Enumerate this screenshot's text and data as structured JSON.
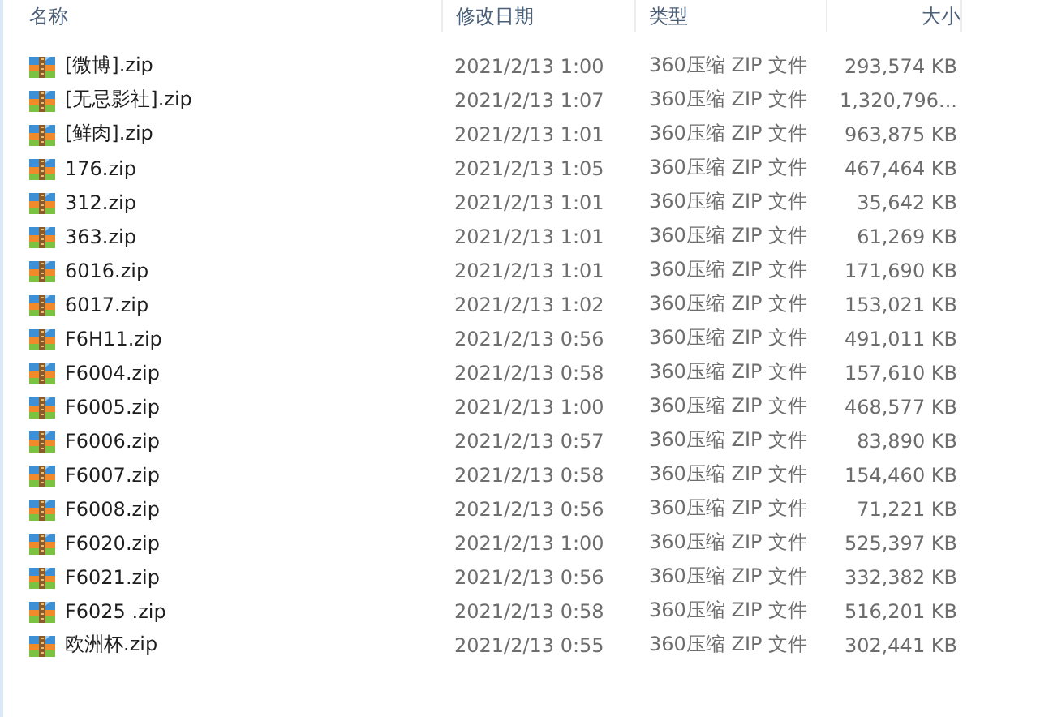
{
  "columns": [
    "名称",
    "修改日期",
    "类型",
    "大小"
  ],
  "files": [
    {
      "name": "[微博].zip",
      "modified": "2021/2/13 1:00",
      "type": "360压缩 ZIP 文件",
      "size": "293,574 KB"
    },
    {
      "name": "[无忌影社].zip",
      "modified": "2021/2/13 1:07",
      "type": "360压缩 ZIP 文件",
      "size": "1,320,796..."
    },
    {
      "name": "[鲜肉].zip",
      "modified": "2021/2/13 1:01",
      "type": "360压缩 ZIP 文件",
      "size": "963,875 KB"
    },
    {
      "name": "176.zip",
      "modified": "2021/2/13 1:05",
      "type": "360压缩 ZIP 文件",
      "size": "467,464 KB"
    },
    {
      "name": "312.zip",
      "modified": "2021/2/13 1:01",
      "type": "360压缩 ZIP 文件",
      "size": "35,642 KB"
    },
    {
      "name": "363.zip",
      "modified": "2021/2/13 1:01",
      "type": "360压缩 ZIP 文件",
      "size": "61,269 KB"
    },
    {
      "name": "6016.zip",
      "modified": "2021/2/13 1:01",
      "type": "360压缩 ZIP 文件",
      "size": "171,690 KB"
    },
    {
      "name": "6017.zip",
      "modified": "2021/2/13 1:02",
      "type": "360压缩 ZIP 文件",
      "size": "153,021 KB"
    },
    {
      "name": "F6H11.zip",
      "modified": "2021/2/13 0:56",
      "type": "360压缩 ZIP 文件",
      "size": "491,011 KB"
    },
    {
      "name": "F6004.zip",
      "modified": "2021/2/13 0:58",
      "type": "360压缩 ZIP 文件",
      "size": "157,610 KB"
    },
    {
      "name": "F6005.zip",
      "modified": "2021/2/13 1:00",
      "type": "360压缩 ZIP 文件",
      "size": "468,577 KB"
    },
    {
      "name": "F6006.zip",
      "modified": "2021/2/13 0:57",
      "type": "360压缩 ZIP 文件",
      "size": "83,890 KB"
    },
    {
      "name": "F6007.zip",
      "modified": "2021/2/13 0:58",
      "type": "360压缩 ZIP 文件",
      "size": "154,460 KB"
    },
    {
      "name": "F6008.zip",
      "modified": "2021/2/13 0:56",
      "type": "360压缩 ZIP 文件",
      "size": "71,221 KB"
    },
    {
      "name": "F6020.zip",
      "modified": "2021/2/13 1:00",
      "type": "360压缩 ZIP 文件",
      "size": "525,397 KB"
    },
    {
      "name": "F6021.zip",
      "modified": "2021/2/13 0:56",
      "type": "360压缩 ZIP 文件",
      "size": "332,382 KB"
    },
    {
      "name": "F6025 .zip",
      "modified": "2021/2/13 0:58",
      "type": "360压缩 ZIP 文件",
      "size": "516,201 KB"
    },
    {
      "name": "欧洲杯.zip",
      "modified": "2021/2/13 0:55",
      "type": "360压缩 ZIP 文件",
      "size": "302,441 KB"
    }
  ]
}
